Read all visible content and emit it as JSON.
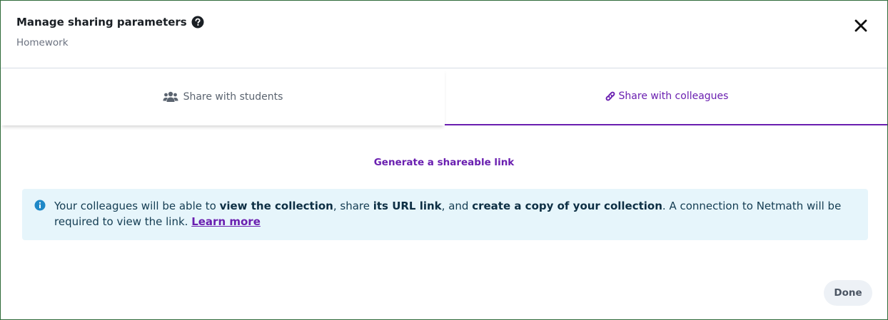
{
  "header": {
    "title": "Manage sharing parameters",
    "subtitle": "Homework"
  },
  "tabs": [
    {
      "label": "Share with students",
      "icon": "users-icon",
      "active": false
    },
    {
      "label": "Share with colleagues",
      "icon": "link-icon",
      "active": true
    }
  ],
  "main": {
    "generate_link": "Generate a shareable link",
    "info": {
      "text_1": "Your colleagues will be able to ",
      "bold_1": "view the collection",
      "text_2": ", share ",
      "bold_2": "its URL link",
      "text_3": ", and ",
      "bold_3": "create a copy of your collection",
      "text_4": ". A connection to Netmath will be required to view the link. ",
      "learn_more": "Learn more"
    }
  },
  "footer": {
    "done_label": "Done"
  },
  "colors": {
    "accent": "#6a1fb0",
    "info_background": "#e6f5fb",
    "info_icon": "#1e88c7",
    "border": "#2f6b3a"
  }
}
